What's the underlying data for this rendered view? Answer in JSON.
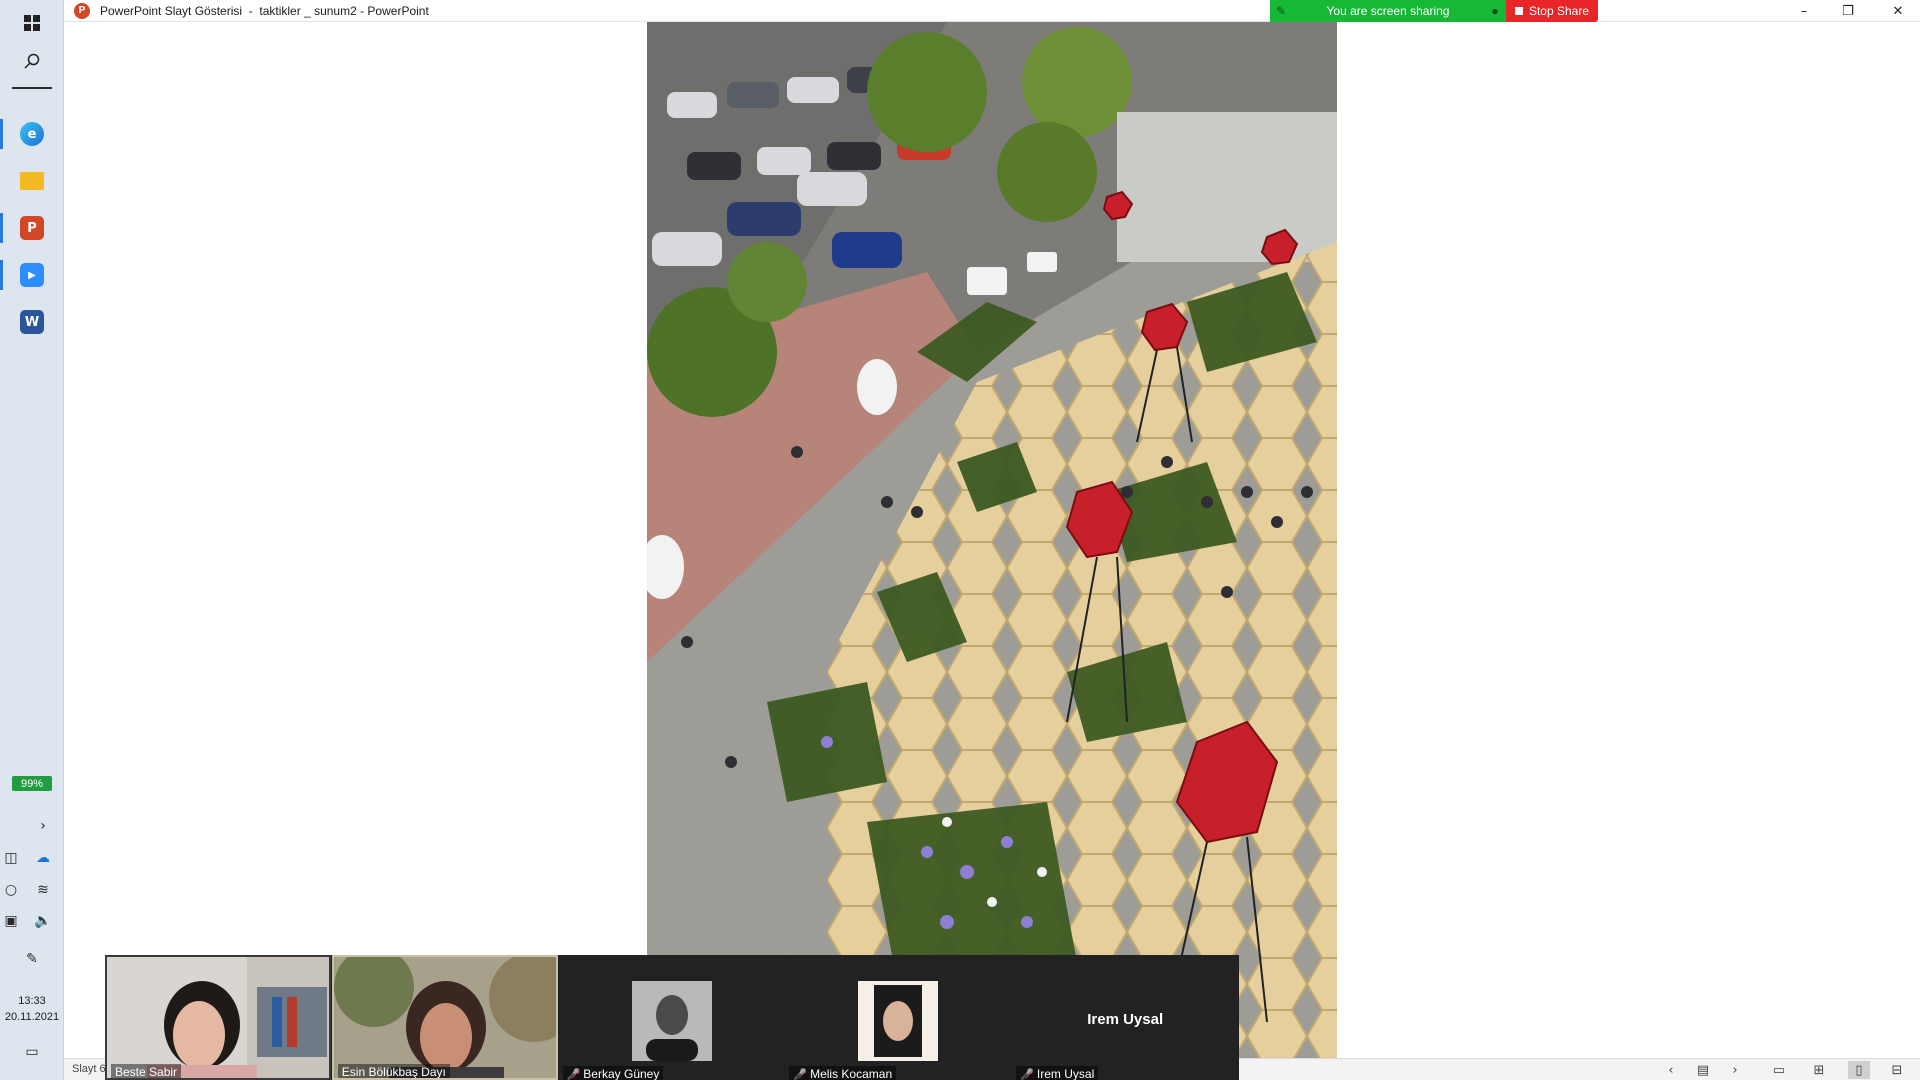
{
  "taskbar": {
    "start_icon": "windows-logo-icon",
    "search_icon": "search-icon",
    "apps": [
      {
        "name": "edge",
        "icon": "edge-icon",
        "letter": "e",
        "color": "#1f8fd6",
        "active": true
      },
      {
        "name": "file-explorer",
        "icon": "folder-icon",
        "letter": "",
        "color": "#f4b921",
        "active": false
      },
      {
        "name": "powerpoint",
        "icon": "powerpoint-icon",
        "letter": "P",
        "color": "#d24726",
        "active": true
      },
      {
        "name": "zoom",
        "icon": "zoom-icon",
        "letter": "▶",
        "color": "#2d8cff",
        "active": true
      },
      {
        "name": "word",
        "icon": "word-icon",
        "letter": "W",
        "color": "#2b579a",
        "active": false
      }
    ],
    "battery": "99%",
    "time": "13:33",
    "date": "20.11.2021"
  },
  "titlebar": {
    "title": "PowerPoint Slayt Gösterisi  -  taktikler _ sunum2 - PowerPoint",
    "share_text": "You are screen sharing",
    "stop_share_label": "Stop Share"
  },
  "statusbar": {
    "slide_indicator": "Slayt 6"
  },
  "participants": [
    {
      "name": "Beste Sabir",
      "type": "video",
      "muted": false,
      "speaking": false
    },
    {
      "name": "Esin Bölükbaş Dayı",
      "type": "video",
      "muted": false,
      "speaking": true
    },
    {
      "name": "Berkay Güney",
      "type": "avatar",
      "muted": true,
      "speaking": false
    },
    {
      "name": "Melis Kocaman",
      "type": "avatar",
      "muted": true,
      "speaking": false
    },
    {
      "name": "Irem Uysal",
      "type": "name-only",
      "muted": true,
      "speaking": false,
      "display_name": "Irem Uysal"
    }
  ],
  "colors": {
    "share_green": "#17b836",
    "stop_red": "#e8262a",
    "zoom_dark": "#1f1f1f",
    "muted_red": "#e0322d"
  }
}
